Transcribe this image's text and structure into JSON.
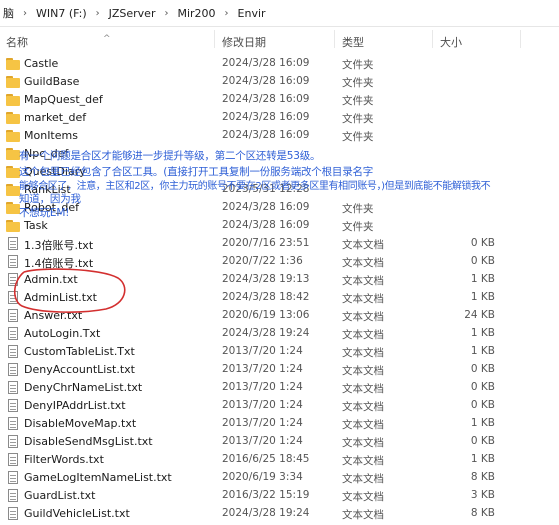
{
  "breadcrumb": {
    "items": [
      "脑",
      "WIN7 (F:)",
      "JZServer",
      "Mir200",
      "Envir"
    ]
  },
  "columns": {
    "name": "名称",
    "date": "修改日期",
    "type": "类型",
    "size": "大小"
  },
  "files": [
    {
      "name": "Castle",
      "date": "2024/3/28 16:09",
      "type": "文件夹",
      "size": "",
      "icon": "folder-icon"
    },
    {
      "name": "GuildBase",
      "date": "2024/3/28 16:09",
      "type": "文件夹",
      "size": "",
      "icon": "folder-icon"
    },
    {
      "name": "MapQuest_def",
      "date": "2024/3/28 16:09",
      "type": "文件夹",
      "size": "",
      "icon": "folder-icon"
    },
    {
      "name": "market_def",
      "date": "2024/3/28 16:09",
      "type": "文件夹",
      "size": "",
      "icon": "folder-icon"
    },
    {
      "name": "MonItems",
      "date": "2024/3/28 16:09",
      "type": "文件夹",
      "size": "",
      "icon": "folder-icon"
    },
    {
      "name": "Npc_def",
      "date": "",
      "type": "",
      "size": "",
      "icon": "folder-icon"
    },
    {
      "name": "QuestDiary",
      "date": "",
      "type": "",
      "size": "",
      "icon": "folder-icon"
    },
    {
      "name": "RankList",
      "date": "2023/5/31 12:28",
      "type": "",
      "size": "",
      "icon": "folder-icon"
    },
    {
      "name": "Robot_def",
      "date": "2024/3/28 16:09",
      "type": "文件夹",
      "size": "",
      "icon": "folder-icon"
    },
    {
      "name": "Task",
      "date": "2024/3/28 16:09",
      "type": "文件夹",
      "size": "",
      "icon": "folder-icon"
    },
    {
      "name": "1.3倍账号.txt",
      "date": "2020/7/16 23:51",
      "type": "文本文档",
      "size": "0 KB",
      "icon": "document-icon"
    },
    {
      "name": "1.4倍账号.txt",
      "date": "2020/7/22 1:36",
      "type": "文本文档",
      "size": "0 KB",
      "icon": "document-icon"
    },
    {
      "name": "Admin.txt",
      "date": "2024/3/28 19:13",
      "type": "文本文档",
      "size": "1 KB",
      "icon": "document-icon"
    },
    {
      "name": "AdminList.txt",
      "date": "2024/3/28 18:42",
      "type": "文本文档",
      "size": "1 KB",
      "icon": "document-icon"
    },
    {
      "name": "Answer.txt",
      "date": "2020/6/19 13:06",
      "type": "文本文档",
      "size": "24 KB",
      "icon": "document-icon"
    },
    {
      "name": "AutoLogin.Txt",
      "date": "2024/3/28 19:24",
      "type": "文本文档",
      "size": "1 KB",
      "icon": "document-icon"
    },
    {
      "name": "CustomTableList.Txt",
      "date": "2013/7/20 1:24",
      "type": "文本文档",
      "size": "1 KB",
      "icon": "document-icon"
    },
    {
      "name": "DenyAccountList.txt",
      "date": "2013/7/20 1:24",
      "type": "文本文档",
      "size": "0 KB",
      "icon": "document-icon"
    },
    {
      "name": "DenyChrNameList.txt",
      "date": "2013/7/20 1:24",
      "type": "文本文档",
      "size": "0 KB",
      "icon": "document-icon"
    },
    {
      "name": "DenyIPAddrList.txt",
      "date": "2013/7/20 1:24",
      "type": "文本文档",
      "size": "0 KB",
      "icon": "document-icon"
    },
    {
      "name": "DisableMoveMap.txt",
      "date": "2013/7/20 1:24",
      "type": "文本文档",
      "size": "1 KB",
      "icon": "document-icon"
    },
    {
      "name": "DisableSendMsgList.txt",
      "date": "2013/7/20 1:24",
      "type": "文本文档",
      "size": "0 KB",
      "icon": "document-icon"
    },
    {
      "name": "FilterWords.txt",
      "date": "2016/6/25 18:45",
      "type": "文本文档",
      "size": "1 KB",
      "icon": "document-icon"
    },
    {
      "name": "GameLogItemNameList.txt",
      "date": "2020/6/19 3:34",
      "type": "文本文档",
      "size": "8 KB",
      "icon": "document-icon"
    },
    {
      "name": "GuardList.txt",
      "date": "2016/3/22 15:19",
      "type": "文本文档",
      "size": "3 KB",
      "icon": "document-icon"
    },
    {
      "name": "GuildVehicleList.txt",
      "date": "2024/3/28 19:24",
      "type": "文本文档",
      "size": "8 KB",
      "icon": "document-icon"
    }
  ],
  "overlay_notes": [
    "有一个问题是合区才能够进一步提升等级，第二个区还转是53级。",
    "这个包里已经包含了合区工具。(直接打开工具复制一份服务端改个根目录名字",
    "能够合区了，注意，主区和2区，你主力玩的账号不要在2区或者更多区里有相同账号，)但是到底能不能解锁我不",
    "知道，因为我",
    "不想玩EM!"
  ],
  "colors": {
    "note_text": "#2e5fd6",
    "annotation_circle": "#d32f2f",
    "folder": "#f6c444"
  }
}
